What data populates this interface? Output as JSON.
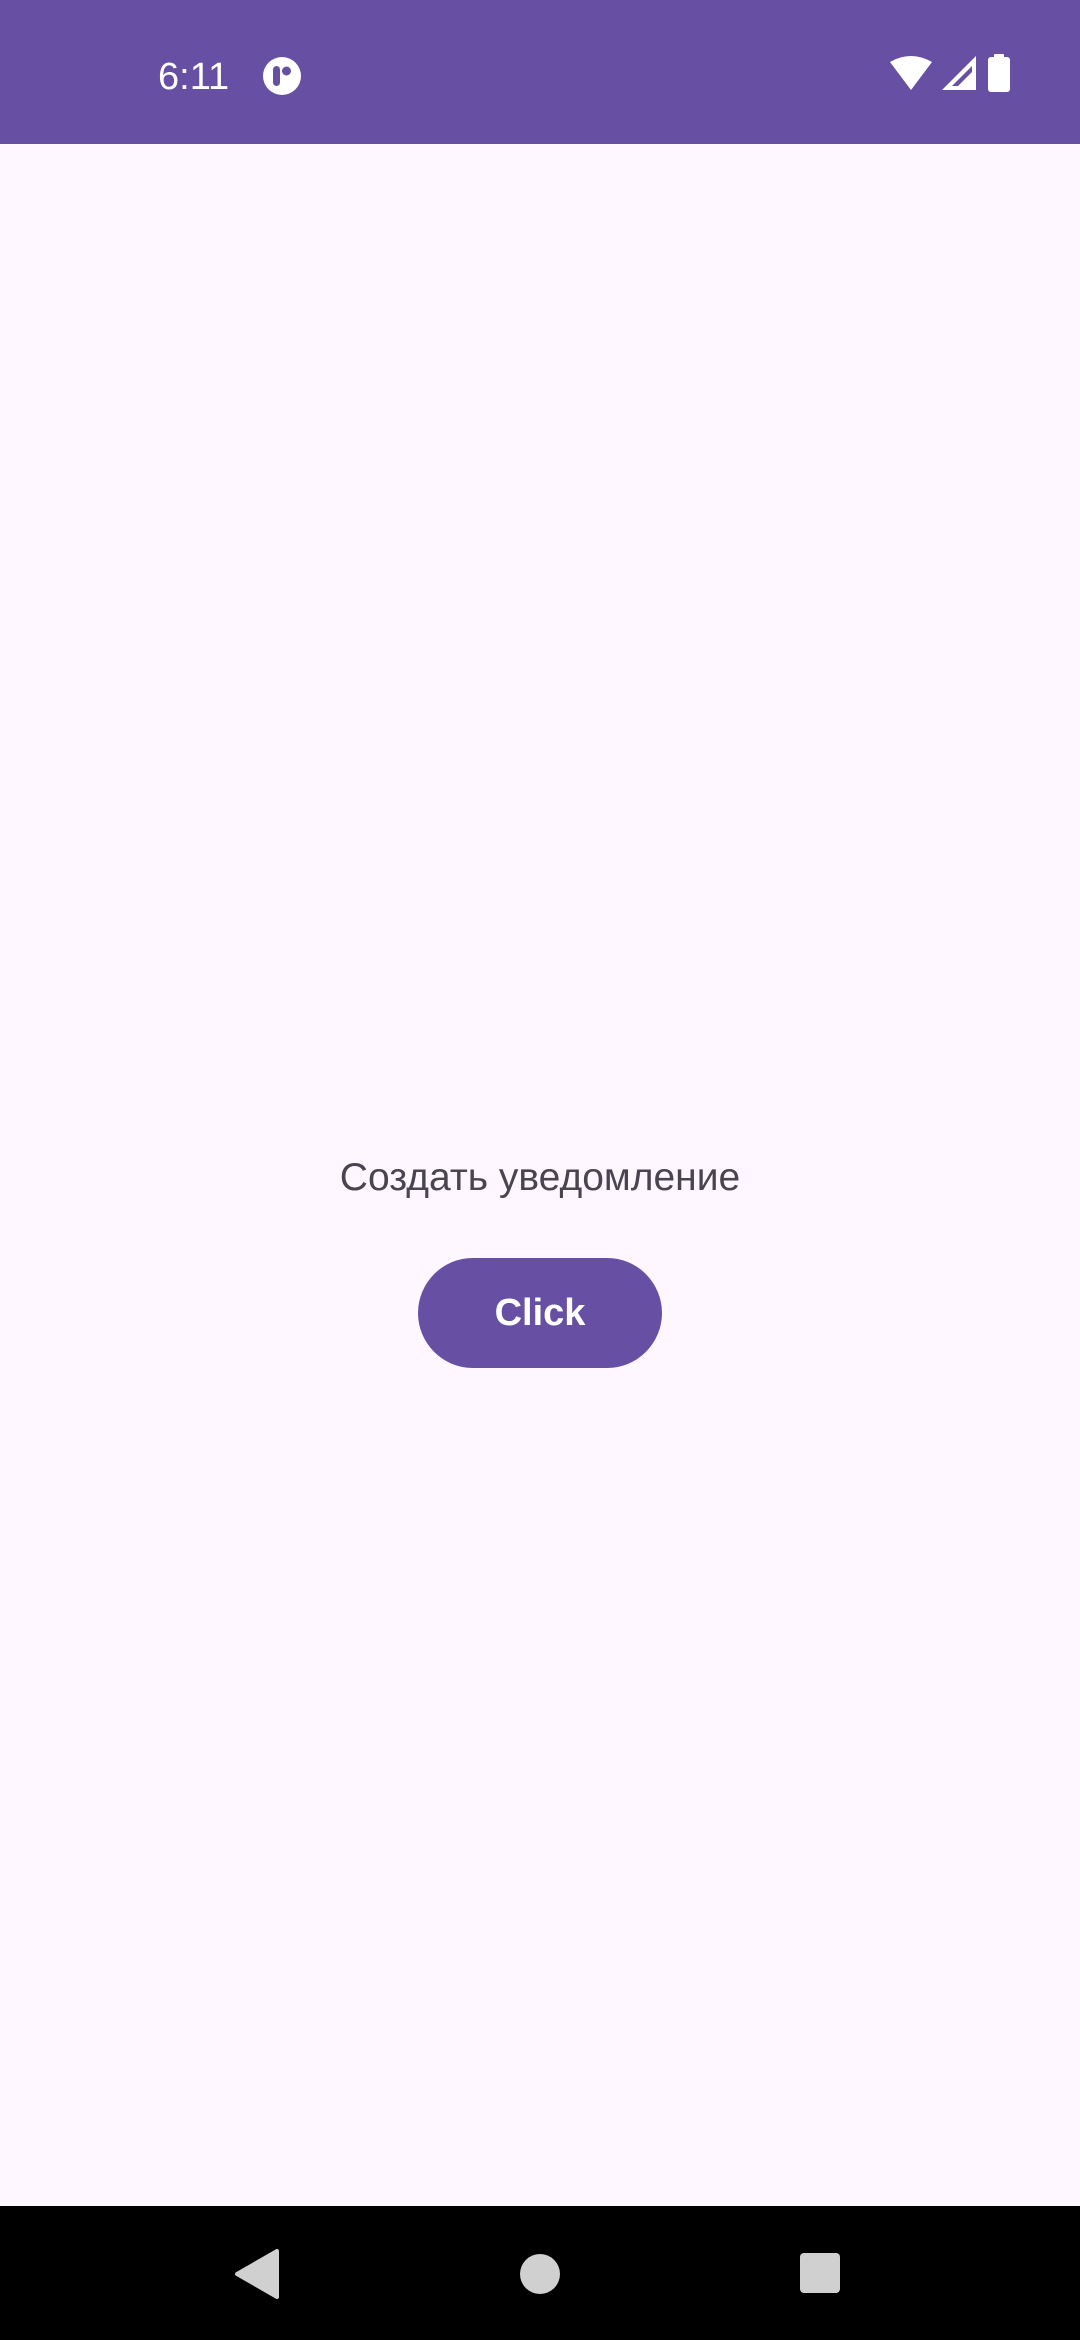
{
  "status_bar": {
    "time": "6:11",
    "background_color": "#6750a4",
    "icons": [
      "app-notification-icon",
      "wifi-icon",
      "cellular-signal-icon",
      "battery-icon"
    ]
  },
  "main": {
    "prompt": "Создать уведомление",
    "button_label": "Click",
    "accent_color": "#6750a4",
    "background_color": "#fef7ff"
  },
  "nav_bar": {
    "icons": [
      "back-icon",
      "home-icon",
      "recents-icon"
    ]
  }
}
